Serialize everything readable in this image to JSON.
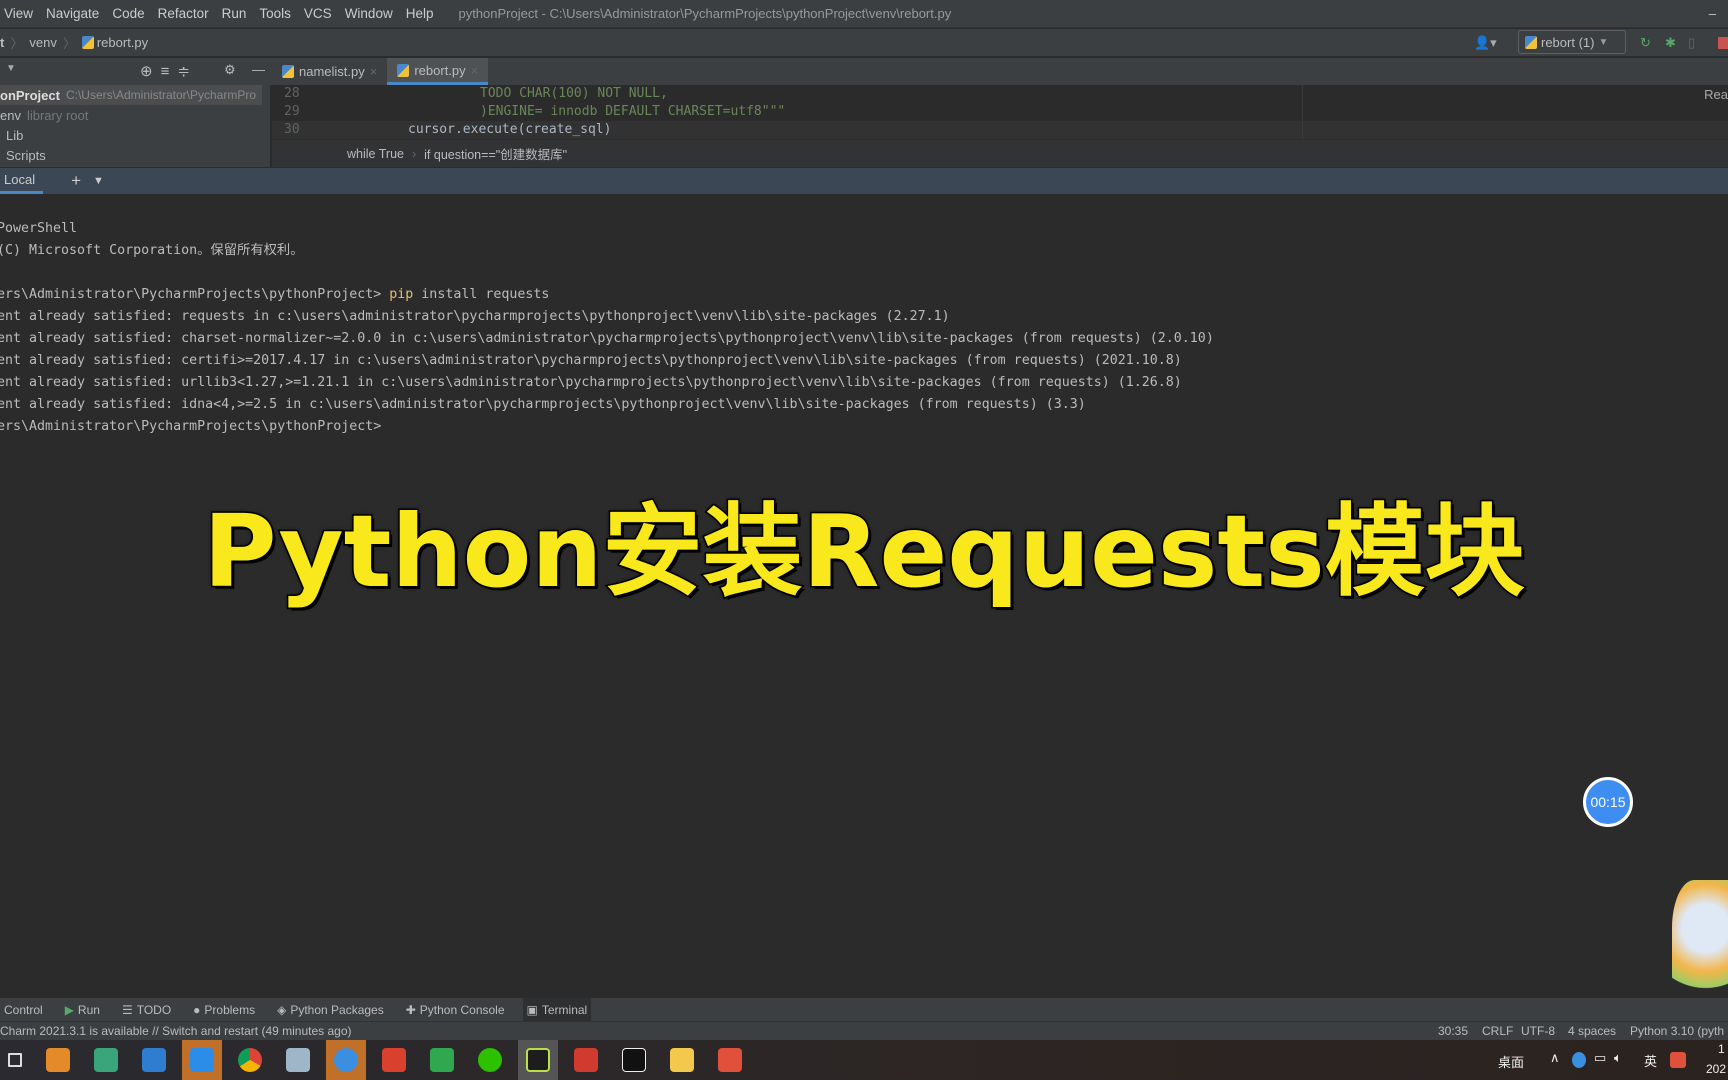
{
  "menu": [
    "View",
    "Navigate",
    "Code",
    "Refactor",
    "Run",
    "Tools",
    "VCS",
    "Window",
    "Help"
  ],
  "window_title": "pythonProject - C:\\Users\\Administrator\\PycharmProjects\\pythonProject\\venv\\rebort.py",
  "nav": {
    "root": "t",
    "venv": "venv",
    "file": "rebort.py",
    "run_config": "rebort (1)"
  },
  "editor_tabs": [
    {
      "label": "namelist.py"
    },
    {
      "label": "rebort.py",
      "active": true
    }
  ],
  "project": {
    "root": "onProject",
    "root_path": "C:\\Users\\Administrator\\PycharmPro",
    "items": [
      "env",
      "library root",
      "Lib",
      "Scripts"
    ]
  },
  "code": [
    {
      "n": "28",
      "text": "TODO CHAR(100) NOT NULL,"
    },
    {
      "n": "29",
      "text": ")ENGINE= innodb DEFAULT CHARSET=utf8\"\"\""
    },
    {
      "n": "30",
      "text": "cursor.execute(create_sql)"
    }
  ],
  "reader_mode": "Rea",
  "code_crumbs": [
    "while True",
    "if question==\"创建数据库\""
  ],
  "terminal_tabs": {
    "local": "Local",
    "add": "+"
  },
  "terminal_lines": [
    "PowerShell",
    "(C) Microsoft Corporation。保留所有权利。",
    "",
    "ers\\Administrator\\PycharmProjects\\pythonProject> pip install requests",
    "ent already satisfied: requests in c:\\users\\administrator\\pycharmprojects\\pythonproject\\venv\\lib\\site-packages (2.27.1)",
    "ent already satisfied: charset-normalizer~=2.0.0 in c:\\users\\administrator\\pycharmprojects\\pythonproject\\venv\\lib\\site-packages (from requests) (2.0.10)",
    "ent already satisfied: certifi>=2017.4.17 in c:\\users\\administrator\\pycharmprojects\\pythonproject\\venv\\lib\\site-packages (from requests) (2021.10.8)",
    "ent already satisfied: urllib3<1.27,>=1.21.1 in c:\\users\\administrator\\pycharmprojects\\pythonproject\\venv\\lib\\site-packages (from requests) (1.26.8)",
    "ent already satisfied: idna<4,>=2.5 in c:\\users\\administrator\\pycharmprojects\\pythonproject\\venv\\lib\\site-packages (from requests) (3.3)",
    "ers\\Administrator\\PycharmProjects\\pythonProject>"
  ],
  "overlay_title": "Python安装Requests模块",
  "timer": "00:15",
  "tool_windows": [
    "Control",
    "Run",
    "TODO",
    "Problems",
    "Python Packages",
    "Python Console",
    "Terminal"
  ],
  "status": {
    "message": "Charm 2021.3.1 is available // Switch and restart (49 minutes ago)",
    "position": "30:35",
    "line_sep": "CRLF",
    "encoding": "UTF-8",
    "indent": "4 spaces",
    "interpreter": "Python 3.10 (pyth"
  },
  "tray": {
    "desktop": "桌面",
    "ime": "英",
    "clock": "1",
    "date": "202"
  },
  "colors": {
    "accent": "#4a88c7",
    "title_yellow": "#f8e81c",
    "terminal_bg": "#2b2b2b"
  }
}
